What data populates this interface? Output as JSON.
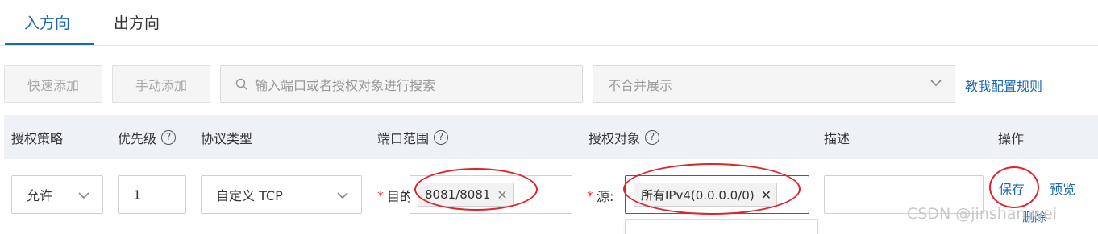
{
  "tabs": [
    {
      "label": "入方向",
      "active": true
    },
    {
      "label": "出方向",
      "active": false
    }
  ],
  "toolbar": {
    "quick_add": "快速添加",
    "manual_add": "手动添加",
    "search_placeholder": "输入端口或者授权对象进行搜索",
    "merge_select": "不合并展示",
    "help_link": "教我配置规则"
  },
  "table": {
    "headers": {
      "policy": "授权策略",
      "priority": "优先级",
      "protocol": "协议类型",
      "port_range": "端口范围",
      "auth_object": "授权对象",
      "description": "描述",
      "actions": "操作"
    },
    "help_glyph": "?",
    "row": {
      "policy": "允许",
      "priority": "1",
      "protocol": "自定义 TCP",
      "port_required": "*",
      "port_label": "目的",
      "port_value": "8081/8081",
      "source_required": "*",
      "source_label": "源:",
      "source_value": "所有IPv4(0.0.0.0/0)",
      "description": "",
      "save": "保存",
      "preview": "预览",
      "delete": "删除"
    }
  },
  "watermark": "CSDN @jinshan.wei",
  "colors": {
    "accent": "#1a66b8",
    "annotation": "#e0242a",
    "header_bg": "#eef1f6"
  }
}
